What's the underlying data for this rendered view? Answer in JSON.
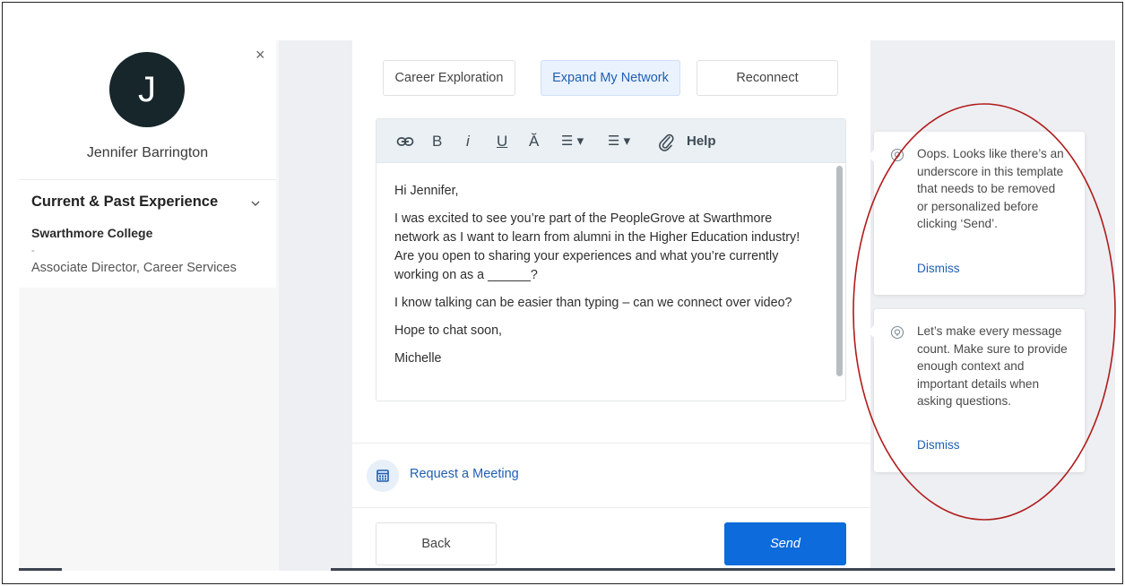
{
  "profile": {
    "initial": "J",
    "name": "Jennifer Barrington",
    "close_symbol": "×"
  },
  "experience": {
    "title": "Current & Past Experience",
    "chevron": "⌄",
    "organization": "Swarthmore College",
    "dash": "-",
    "role": "Associate Director, Career Services"
  },
  "tabs": [
    {
      "label": "Career Exploration",
      "active": false
    },
    {
      "label": "Expand My Network",
      "active": true
    },
    {
      "label": "Reconnect",
      "active": false
    }
  ],
  "toolbar": {
    "link_icon": "link-icon",
    "bold": "B",
    "italic": "i",
    "underline": "U",
    "clear_format": "Ă",
    "ordered_list": "☰ ▾",
    "bullet_list": "☰ ▾",
    "attach_icon": "paperclip-icon",
    "help": "Help"
  },
  "message": {
    "greeting": "Hi Jennifer,",
    "paragraph1": "I was excited to see you’re part of the PeopleGrove at Swarthmore network as I want to learn from alumni in the Higher Education industry! Are you open to sharing your experiences and what you’re currently working on as a ______?",
    "paragraph2": "I know talking can be easier than typing – can we connect over video?",
    "closing": "Hope to chat soon,",
    "signature": "Michelle"
  },
  "meeting": {
    "label": "Request a Meeting",
    "icon": "calendar-icon"
  },
  "buttons": {
    "back": "Back",
    "send": "Send"
  },
  "tips": [
    {
      "text": "Oops. Looks like there’s an underscore in this template that needs to be removed or personalized before clicking ‘Send’.",
      "dismiss": "Dismiss",
      "icon": "lightbulb-icon"
    },
    {
      "text": "Let’s make every message count. Make sure to provide enough context and important details when asking questions.",
      "dismiss": "Dismiss",
      "icon": "lightbulb-icon"
    }
  ],
  "colors": {
    "accent": "#0e6bdc",
    "link": "#1f5fb3",
    "avatar_bg": "#16262b",
    "annotation": "#b01c1c"
  }
}
